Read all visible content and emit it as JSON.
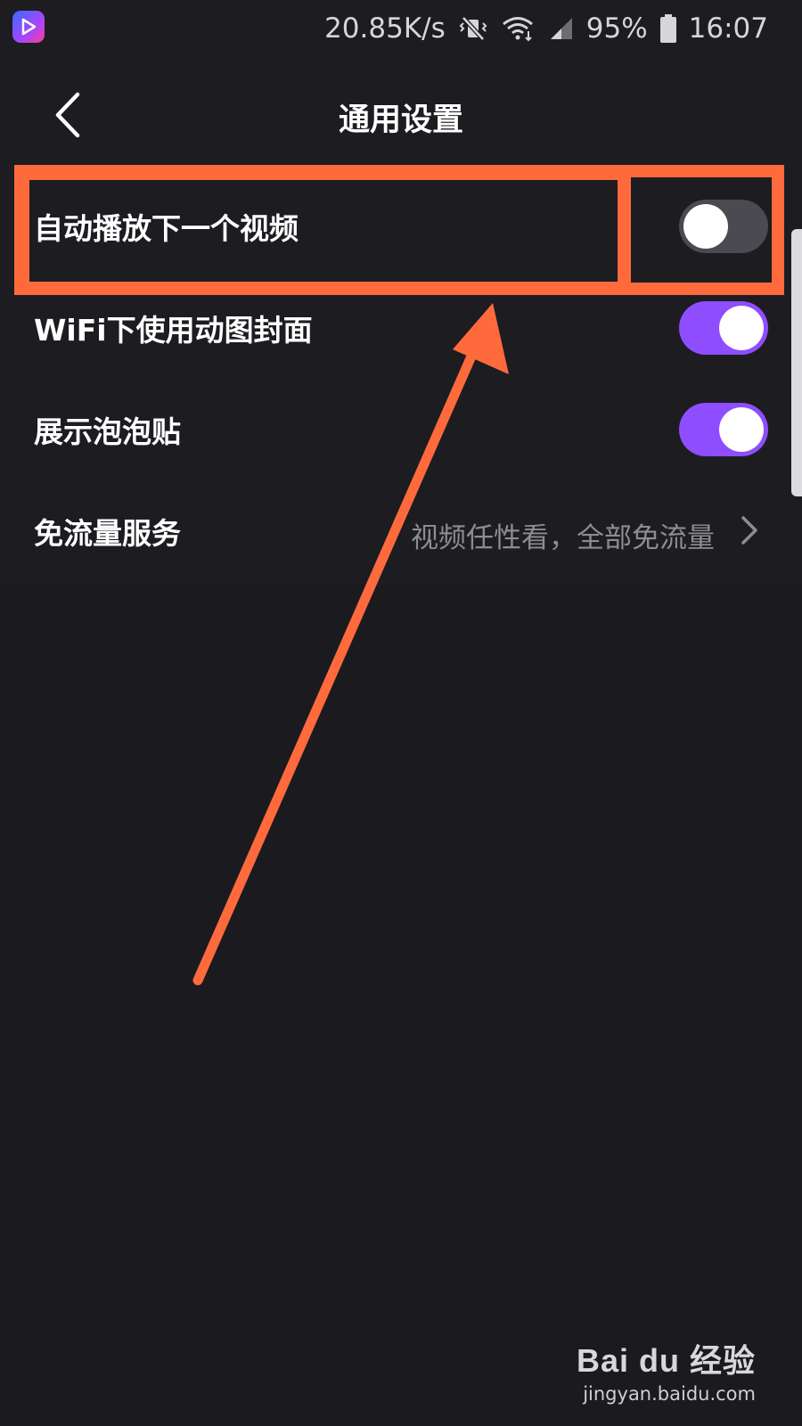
{
  "status_bar": {
    "net_speed": "20.85K/s",
    "battery": "95%",
    "time": "16:07",
    "icons": [
      "app-icon",
      "vibrate-icon",
      "wifi-icon",
      "signal-icon",
      "battery-icon"
    ]
  },
  "header": {
    "title": "通用设置",
    "back_icon": "chevron-left-icon"
  },
  "settings": {
    "items": [
      {
        "label": "自动播放下一个视频",
        "type": "toggle",
        "enabled": false
      },
      {
        "label": "WiFi下使用动图封面",
        "type": "toggle",
        "enabled": true
      },
      {
        "label": "展示泡泡贴",
        "type": "toggle",
        "enabled": true
      },
      {
        "label": "免流量服务",
        "type": "link",
        "value": "视频任性看，全部免流量"
      }
    ]
  },
  "colors": {
    "background": "#1b1a1f",
    "toggle_on": "#8e4dff",
    "toggle_off": "#4b4a50",
    "annotation": "#ff6a3d",
    "secondary_text": "#8d8c92"
  },
  "watermark": {
    "logo": "Bai du 经验",
    "url": "jingyan.baidu.com"
  }
}
